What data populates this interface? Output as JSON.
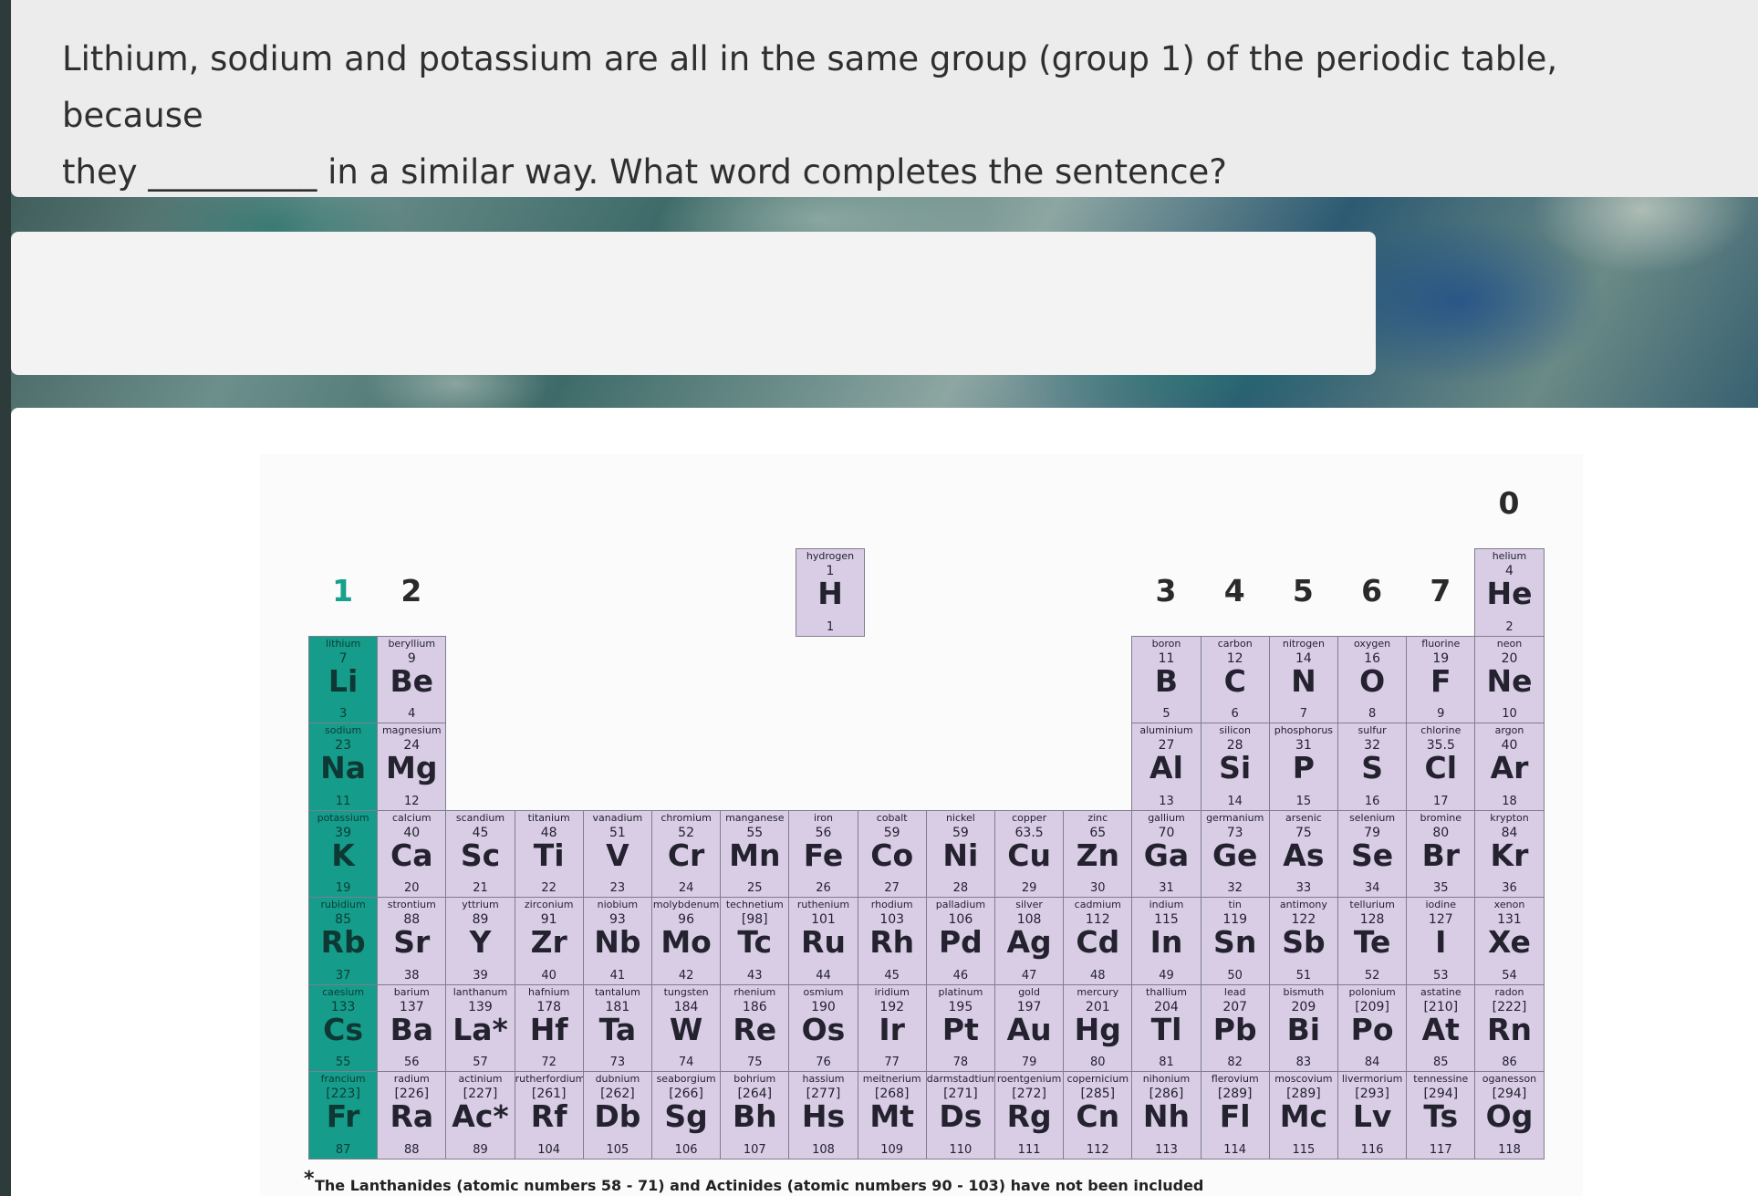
{
  "question": {
    "line1": "Lithium, sodium and potassium are all in the same group (group 1) of the periodic table, because",
    "line2_start": "they",
    "blank": "__________",
    "line2_end": " in a similar way. What word completes the sentence?"
  },
  "answer": {
    "value": "",
    "placeholder": ""
  },
  "periodic_table": {
    "group_labels": [
      {
        "text": "1",
        "col": 0,
        "row": 0
      },
      {
        "text": "2",
        "col": 1,
        "row": 0
      },
      {
        "text": "3",
        "col": 12,
        "row": 0
      },
      {
        "text": "4",
        "col": 13,
        "row": 0
      },
      {
        "text": "5",
        "col": 14,
        "row": 0
      },
      {
        "text": "6",
        "col": 15,
        "row": 0
      },
      {
        "text": "7",
        "col": 16,
        "row": 0
      },
      {
        "text": "0",
        "col": 17,
        "row": -1
      }
    ],
    "footnote_star": "*",
    "footnote": "The Lanthanides (atomic numbers 58 - 71) and Actinides (atomic numbers 90 - 103) have not been included",
    "elements": [
      {
        "n": "hydrogen",
        "m": "1",
        "s": "H",
        "z": "1",
        "row": 0,
        "col": 7.1
      },
      {
        "n": "helium",
        "m": "4",
        "s": "He",
        "z": "2",
        "row": 0,
        "col": 17
      },
      {
        "n": "lithium",
        "m": "7",
        "s": "Li",
        "z": "3",
        "row": 1,
        "col": 0
      },
      {
        "n": "beryllium",
        "m": "9",
        "s": "Be",
        "z": "4",
        "row": 1,
        "col": 1
      },
      {
        "n": "boron",
        "m": "11",
        "s": "B",
        "z": "5",
        "row": 1,
        "col": 12
      },
      {
        "n": "carbon",
        "m": "12",
        "s": "C",
        "z": "6",
        "row": 1,
        "col": 13
      },
      {
        "n": "nitrogen",
        "m": "14",
        "s": "N",
        "z": "7",
        "row": 1,
        "col": 14
      },
      {
        "n": "oxygen",
        "m": "16",
        "s": "O",
        "z": "8",
        "row": 1,
        "col": 15
      },
      {
        "n": "fluorine",
        "m": "19",
        "s": "F",
        "z": "9",
        "row": 1,
        "col": 16
      },
      {
        "n": "neon",
        "m": "20",
        "s": "Ne",
        "z": "10",
        "row": 1,
        "col": 17
      },
      {
        "n": "sodium",
        "m": "23",
        "s": "Na",
        "z": "11",
        "row": 2,
        "col": 0
      },
      {
        "n": "magnesium",
        "m": "24",
        "s": "Mg",
        "z": "12",
        "row": 2,
        "col": 1
      },
      {
        "n": "aluminium",
        "m": "27",
        "s": "Al",
        "z": "13",
        "row": 2,
        "col": 12
      },
      {
        "n": "silicon",
        "m": "28",
        "s": "Si",
        "z": "14",
        "row": 2,
        "col": 13
      },
      {
        "n": "phosphorus",
        "m": "31",
        "s": "P",
        "z": "15",
        "row": 2,
        "col": 14
      },
      {
        "n": "sulfur",
        "m": "32",
        "s": "S",
        "z": "16",
        "row": 2,
        "col": 15
      },
      {
        "n": "chlorine",
        "m": "35.5",
        "s": "Cl",
        "z": "17",
        "row": 2,
        "col": 16
      },
      {
        "n": "argon",
        "m": "40",
        "s": "Ar",
        "z": "18",
        "row": 2,
        "col": 17
      },
      {
        "n": "potassium",
        "m": "39",
        "s": "K",
        "z": "19",
        "row": 3,
        "col": 0
      },
      {
        "n": "calcium",
        "m": "40",
        "s": "Ca",
        "z": "20",
        "row": 3,
        "col": 1
      },
      {
        "n": "scandium",
        "m": "45",
        "s": "Sc",
        "z": "21",
        "row": 3,
        "col": 2
      },
      {
        "n": "titanium",
        "m": "48",
        "s": "Ti",
        "z": "22",
        "row": 3,
        "col": 3
      },
      {
        "n": "vanadium",
        "m": "51",
        "s": "V",
        "z": "23",
        "row": 3,
        "col": 4
      },
      {
        "n": "chromium",
        "m": "52",
        "s": "Cr",
        "z": "24",
        "row": 3,
        "col": 5
      },
      {
        "n": "manganese",
        "m": "55",
        "s": "Mn",
        "z": "25",
        "row": 3,
        "col": 6
      },
      {
        "n": "iron",
        "m": "56",
        "s": "Fe",
        "z": "26",
        "row": 3,
        "col": 7
      },
      {
        "n": "cobalt",
        "m": "59",
        "s": "Co",
        "z": "27",
        "row": 3,
        "col": 8
      },
      {
        "n": "nickel",
        "m": "59",
        "s": "Ni",
        "z": "28",
        "row": 3,
        "col": 9
      },
      {
        "n": "copper",
        "m": "63.5",
        "s": "Cu",
        "z": "29",
        "row": 3,
        "col": 10
      },
      {
        "n": "zinc",
        "m": "65",
        "s": "Zn",
        "z": "30",
        "row": 3,
        "col": 11
      },
      {
        "n": "gallium",
        "m": "70",
        "s": "Ga",
        "z": "31",
        "row": 3,
        "col": 12
      },
      {
        "n": "germanium",
        "m": "73",
        "s": "Ge",
        "z": "32",
        "row": 3,
        "col": 13
      },
      {
        "n": "arsenic",
        "m": "75",
        "s": "As",
        "z": "33",
        "row": 3,
        "col": 14
      },
      {
        "n": "selenium",
        "m": "79",
        "s": "Se",
        "z": "34",
        "row": 3,
        "col": 15
      },
      {
        "n": "bromine",
        "m": "80",
        "s": "Br",
        "z": "35",
        "row": 3,
        "col": 16
      },
      {
        "n": "krypton",
        "m": "84",
        "s": "Kr",
        "z": "36",
        "row": 3,
        "col": 17
      },
      {
        "n": "rubidium",
        "m": "85",
        "s": "Rb",
        "z": "37",
        "row": 4,
        "col": 0
      },
      {
        "n": "strontium",
        "m": "88",
        "s": "Sr",
        "z": "38",
        "row": 4,
        "col": 1
      },
      {
        "n": "yttrium",
        "m": "89",
        "s": "Y",
        "z": "39",
        "row": 4,
        "col": 2
      },
      {
        "n": "zirconium",
        "m": "91",
        "s": "Zr",
        "z": "40",
        "row": 4,
        "col": 3
      },
      {
        "n": "niobium",
        "m": "93",
        "s": "Nb",
        "z": "41",
        "row": 4,
        "col": 4
      },
      {
        "n": "molybdenum",
        "m": "96",
        "s": "Mo",
        "z": "42",
        "row": 4,
        "col": 5
      },
      {
        "n": "technetium",
        "m": "[98]",
        "s": "Tc",
        "z": "43",
        "row": 4,
        "col": 6
      },
      {
        "n": "ruthenium",
        "m": "101",
        "s": "Ru",
        "z": "44",
        "row": 4,
        "col": 7
      },
      {
        "n": "rhodium",
        "m": "103",
        "s": "Rh",
        "z": "45",
        "row": 4,
        "col": 8
      },
      {
        "n": "palladium",
        "m": "106",
        "s": "Pd",
        "z": "46",
        "row": 4,
        "col": 9
      },
      {
        "n": "silver",
        "m": "108",
        "s": "Ag",
        "z": "47",
        "row": 4,
        "col": 10
      },
      {
        "n": "cadmium",
        "m": "112",
        "s": "Cd",
        "z": "48",
        "row": 4,
        "col": 11
      },
      {
        "n": "indium",
        "m": "115",
        "s": "In",
        "z": "49",
        "row": 4,
        "col": 12
      },
      {
        "n": "tin",
        "m": "119",
        "s": "Sn",
        "z": "50",
        "row": 4,
        "col": 13
      },
      {
        "n": "antimony",
        "m": "122",
        "s": "Sb",
        "z": "51",
        "row": 4,
        "col": 14
      },
      {
        "n": "tellurium",
        "m": "128",
        "s": "Te",
        "z": "52",
        "row": 4,
        "col": 15
      },
      {
        "n": "iodine",
        "m": "127",
        "s": "I",
        "z": "53",
        "row": 4,
        "col": 16
      },
      {
        "n": "xenon",
        "m": "131",
        "s": "Xe",
        "z": "54",
        "row": 4,
        "col": 17
      },
      {
        "n": "caesium",
        "m": "133",
        "s": "Cs",
        "z": "55",
        "row": 5,
        "col": 0
      },
      {
        "n": "barium",
        "m": "137",
        "s": "Ba",
        "z": "56",
        "row": 5,
        "col": 1
      },
      {
        "n": "lanthanum",
        "m": "139",
        "s": "La*",
        "z": "57",
        "row": 5,
        "col": 2
      },
      {
        "n": "hafnium",
        "m": "178",
        "s": "Hf",
        "z": "72",
        "row": 5,
        "col": 3
      },
      {
        "n": "tantalum",
        "m": "181",
        "s": "Ta",
        "z": "73",
        "row": 5,
        "col": 4
      },
      {
        "n": "tungsten",
        "m": "184",
        "s": "W",
        "z": "74",
        "row": 5,
        "col": 5
      },
      {
        "n": "rhenium",
        "m": "186",
        "s": "Re",
        "z": "75",
        "row": 5,
        "col": 6
      },
      {
        "n": "osmium",
        "m": "190",
        "s": "Os",
        "z": "76",
        "row": 5,
        "col": 7
      },
      {
        "n": "iridium",
        "m": "192",
        "s": "Ir",
        "z": "77",
        "row": 5,
        "col": 8
      },
      {
        "n": "platinum",
        "m": "195",
        "s": "Pt",
        "z": "78",
        "row": 5,
        "col": 9
      },
      {
        "n": "gold",
        "m": "197",
        "s": "Au",
        "z": "79",
        "row": 5,
        "col": 10
      },
      {
        "n": "mercury",
        "m": "201",
        "s": "Hg",
        "z": "80",
        "row": 5,
        "col": 11
      },
      {
        "n": "thallium",
        "m": "204",
        "s": "Tl",
        "z": "81",
        "row": 5,
        "col": 12
      },
      {
        "n": "lead",
        "m": "207",
        "s": "Pb",
        "z": "82",
        "row": 5,
        "col": 13
      },
      {
        "n": "bismuth",
        "m": "209",
        "s": "Bi",
        "z": "83",
        "row": 5,
        "col": 14
      },
      {
        "n": "polonium",
        "m": "[209]",
        "s": "Po",
        "z": "84",
        "row": 5,
        "col": 15
      },
      {
        "n": "astatine",
        "m": "[210]",
        "s": "At",
        "z": "85",
        "row": 5,
        "col": 16
      },
      {
        "n": "radon",
        "m": "[222]",
        "s": "Rn",
        "z": "86",
        "row": 5,
        "col": 17
      },
      {
        "n": "francium",
        "m": "[223]",
        "s": "Fr",
        "z": "87",
        "row": 6,
        "col": 0
      },
      {
        "n": "radium",
        "m": "[226]",
        "s": "Ra",
        "z": "88",
        "row": 6,
        "col": 1
      },
      {
        "n": "actinium",
        "m": "[227]",
        "s": "Ac*",
        "z": "89",
        "row": 6,
        "col": 2
      },
      {
        "n": "rutherfordium",
        "m": "[261]",
        "s": "Rf",
        "z": "104",
        "row": 6,
        "col": 3
      },
      {
        "n": "dubnium",
        "m": "[262]",
        "s": "Db",
        "z": "105",
        "row": 6,
        "col": 4
      },
      {
        "n": "seaborgium",
        "m": "[266]",
        "s": "Sg",
        "z": "106",
        "row": 6,
        "col": 5
      },
      {
        "n": "bohrium",
        "m": "[264]",
        "s": "Bh",
        "z": "107",
        "row": 6,
        "col": 6
      },
      {
        "n": "hassium",
        "m": "[277]",
        "s": "Hs",
        "z": "108",
        "row": 6,
        "col": 7
      },
      {
        "n": "meitnerium",
        "m": "[268]",
        "s": "Mt",
        "z": "109",
        "row": 6,
        "col": 8
      },
      {
        "n": "darmstadtium",
        "m": "[271]",
        "s": "Ds",
        "z": "110",
        "row": 6,
        "col": 9
      },
      {
        "n": "roentgenium",
        "m": "[272]",
        "s": "Rg",
        "z": "111",
        "row": 6,
        "col": 10
      },
      {
        "n": "copernicium",
        "m": "[285]",
        "s": "Cn",
        "z": "112",
        "row": 6,
        "col": 11
      },
      {
        "n": "nihonium",
        "m": "[286]",
        "s": "Nh",
        "z": "113",
        "row": 6,
        "col": 12
      },
      {
        "n": "flerovium",
        "m": "[289]",
        "s": "Fl",
        "z": "114",
        "row": 6,
        "col": 13
      },
      {
        "n": "moscovium",
        "m": "[289]",
        "s": "Mc",
        "z": "115",
        "row": 6,
        "col": 14
      },
      {
        "n": "livermorium",
        "m": "[293]",
        "s": "Lv",
        "z": "116",
        "row": 6,
        "col": 15
      },
      {
        "n": "tennessine",
        "m": "[294]",
        "s": "Ts",
        "z": "117",
        "row": 6,
        "col": 16
      },
      {
        "n": "oganesson",
        "m": "[294]",
        "s": "Og",
        "z": "118",
        "row": 6,
        "col": 17
      }
    ]
  },
  "colors": {
    "group1": "#169c8a",
    "element_fill": "#d9cde6",
    "panel": "#ececec"
  }
}
